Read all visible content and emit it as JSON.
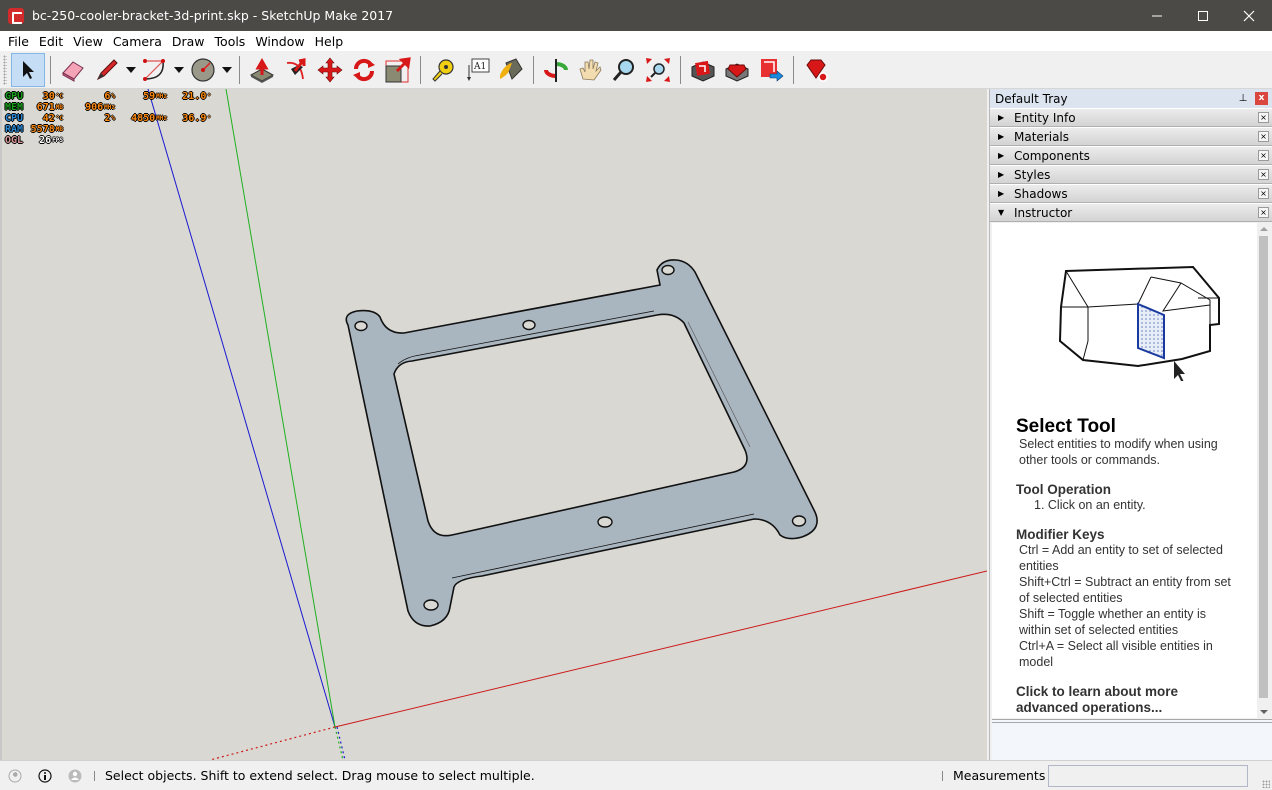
{
  "window": {
    "title": "bc-250-cooler-bracket-3d-print.skp - SketchUp Make 2017",
    "app_icon": "sketchup-logo-icon",
    "controls": [
      "minimize-icon",
      "maximize-icon",
      "close-icon"
    ]
  },
  "menu": {
    "items": [
      "File",
      "Edit",
      "View",
      "Camera",
      "Draw",
      "Tools",
      "Window",
      "Help"
    ]
  },
  "toolbar": {
    "tools": [
      {
        "name": "select",
        "icon": "arrow-cursor-icon",
        "active": true
      },
      {
        "name": "eraser",
        "icon": "eraser-icon"
      },
      {
        "name": "line",
        "icon": "pencil-icon",
        "dropdown": true
      },
      {
        "name": "arc",
        "icon": "arc-icon",
        "dropdown": true
      },
      {
        "name": "circle",
        "icon": "circle-icon",
        "dropdown": true
      },
      {
        "name": "push-pull",
        "icon": "push-pull-icon"
      },
      {
        "name": "follow-me",
        "icon": "follow-me-icon"
      },
      {
        "name": "move",
        "icon": "move-icon"
      },
      {
        "name": "rotate",
        "icon": "rotate-icon"
      },
      {
        "name": "scale",
        "icon": "scale-icon"
      },
      {
        "name": "tape-measure",
        "icon": "tape-measure-icon"
      },
      {
        "name": "text",
        "icon": "text-label-icon",
        "label": "A1"
      },
      {
        "name": "paint-bucket",
        "icon": "paint-bucket-icon"
      },
      {
        "name": "orbit",
        "icon": "orbit-icon"
      },
      {
        "name": "pan",
        "icon": "pan-hand-icon"
      },
      {
        "name": "zoom",
        "icon": "magnifier-icon"
      },
      {
        "name": "zoom-extents",
        "icon": "zoom-extents-icon"
      },
      {
        "name": "3d-warehouse",
        "icon": "warehouse-icon"
      },
      {
        "name": "extension-warehouse",
        "icon": "extension-warehouse-icon"
      },
      {
        "name": "share-model",
        "icon": "share-model-icon"
      },
      {
        "name": "extension-manager",
        "icon": "ruby-gear-icon"
      }
    ]
  },
  "overlay": {
    "rows": [
      {
        "label": "GPU",
        "color": "#1aa01a",
        "cols": [
          {
            "v": "30",
            "u": "°C"
          },
          {
            "v": "6",
            "u": "%"
          },
          {
            "v": "59",
            "u": "MHz"
          },
          {
            "v": "21.0",
            "u": "°"
          }
        ]
      },
      {
        "label": "MEM",
        "color": "#1aa01a",
        "cols": [
          {
            "v": "671",
            "u": "MB"
          },
          {
            "v": "906",
            "u": "MHz"
          },
          {
            "v": "",
            "u": ""
          },
          {
            "v": "",
            "u": ""
          }
        ]
      },
      {
        "label": "CPU",
        "color": "#2a8ad6",
        "cols": [
          {
            "v": "42",
            "u": "°C"
          },
          {
            "v": "2",
            "u": "%"
          },
          {
            "v": "4850",
            "u": "MHz"
          },
          {
            "v": "36.9",
            "u": "°"
          }
        ]
      },
      {
        "label": "RAM",
        "color": "#2a8ad6",
        "cols": [
          {
            "v": "5578",
            "u": "MB"
          },
          {
            "v": "",
            "u": ""
          },
          {
            "v": "",
            "u": ""
          },
          {
            "v": "",
            "u": ""
          }
        ]
      },
      {
        "label": "OGL",
        "color": "#d89a9a",
        "cols": [
          {
            "v": "26",
            "u": "FPS",
            "white": true
          },
          {
            "v": "",
            "u": ""
          },
          {
            "v": "",
            "u": ""
          },
          {
            "v": "",
            "u": ""
          }
        ]
      }
    ]
  },
  "tray": {
    "title": "Default Tray",
    "panels": [
      {
        "label": "Entity Info",
        "expanded": false
      },
      {
        "label": "Materials",
        "expanded": false
      },
      {
        "label": "Components",
        "expanded": false
      },
      {
        "label": "Styles",
        "expanded": false
      },
      {
        "label": "Shadows",
        "expanded": false
      },
      {
        "label": "Instructor",
        "expanded": true
      }
    ],
    "instructor": {
      "title": "Select Tool",
      "description": "Select entities to modify when using other tools or commands.",
      "operation_heading": "Tool Operation",
      "operation_steps": "1. Click on an entity.",
      "modifier_heading": "Modifier Keys",
      "modifiers": [
        "Ctrl = Add an entity to set of selected entities",
        "Shift+Ctrl = Subtract an entity from set of selected entities",
        "Shift = Toggle whether an entity is within set of selected entities",
        "Ctrl+A = Select all visible entities in model"
      ],
      "more_link": "Click to learn about more advanced operations..."
    }
  },
  "statusbar": {
    "icons": [
      "geolocation-icon",
      "info-icon",
      "user-account-icon"
    ],
    "message": "Select objects. Shift to extend select. Drag mouse to select multiple.",
    "measurements_label": "Measurements",
    "measurements_value": ""
  },
  "colors": {
    "axis_red": "#cc1a1a",
    "axis_green": "#20b020",
    "axis_blue": "#1a1ad0",
    "model_face": "#a9b5bf",
    "viewport_bg": "#d9d8d3"
  }
}
